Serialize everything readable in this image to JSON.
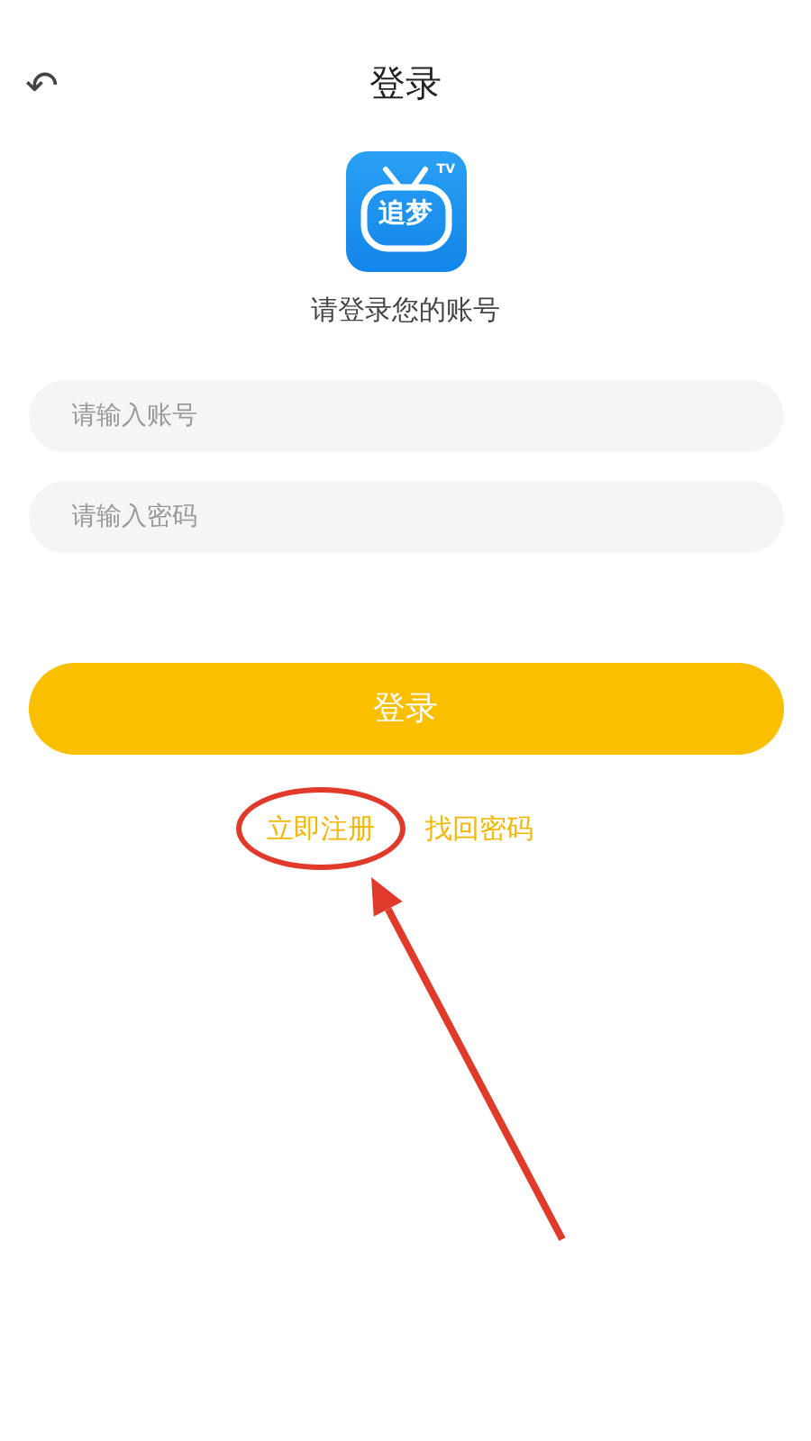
{
  "header": {
    "back_icon": "↶",
    "title": "登录"
  },
  "logo": {
    "text": "追梦",
    "badge": "TV"
  },
  "subtitle": "请登录您的账号",
  "fields": [
    {
      "placeholder": "请输入账号"
    },
    {
      "placeholder": "请输入密码"
    }
  ],
  "login_button": "登录",
  "links": [
    {
      "label": "立即注册",
      "circled": true
    },
    {
      "label": "找回密码",
      "circled": false
    }
  ]
}
